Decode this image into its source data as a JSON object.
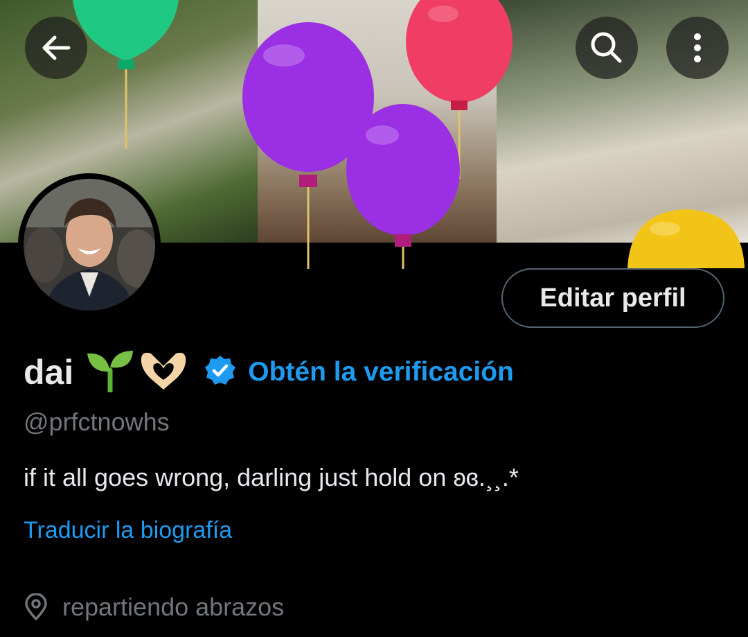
{
  "header": {
    "back_icon": "arrow-left-icon",
    "search_icon": "search-icon",
    "more_icon": "more-vertical-icon"
  },
  "banner": {
    "decoration": "balloons"
  },
  "profile": {
    "display_name": "dai",
    "name_emojis": [
      "seedling",
      "heart-hands"
    ],
    "verified_icon": "verified-badge-icon",
    "get_verified_label": "Obtén la verificación",
    "handle": "@prfctnowhs",
    "bio": "if it all goes wrong, darling just hold on ʚɞ.¸¸.*",
    "translate_bio_label": "Traducir la biografía",
    "location_icon": "location-pin-icon",
    "location": "repartiendo abrazos"
  },
  "actions": {
    "edit_profile_label": "Editar perfil"
  },
  "colors": {
    "background": "#000000",
    "text_primary": "#e7e9ea",
    "text_secondary": "#71767b",
    "accent": "#1d9bf0",
    "button_border": "#536471"
  }
}
